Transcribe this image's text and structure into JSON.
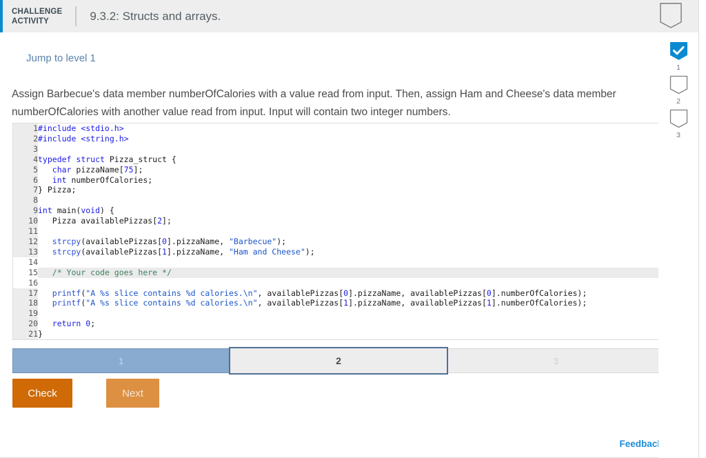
{
  "header": {
    "challenge_label": "CHALLENGE\nACTIVITY",
    "title": "9.3.2: Structs and arrays.",
    "badge_icon": "shield-outline-icon",
    "accent_color": "#0c8ad0"
  },
  "rail": {
    "items": [
      {
        "number": "1",
        "state": "complete",
        "icon": "shield-check-icon"
      },
      {
        "number": "2",
        "state": "incomplete",
        "icon": "shield-outline-icon"
      },
      {
        "number": "3",
        "state": "incomplete",
        "icon": "shield-outline-icon"
      }
    ],
    "complete_color": "#0c8ad0",
    "outline_color": "#808080"
  },
  "main": {
    "jump_link": "Jump to level 1",
    "prompt": "Assign Barbecue's data member numberOfCalories with a value read from input. Then, assign Ham and Cheese's data member numberOfCalories with another value read from input. Input will contain two integer numbers."
  },
  "code": {
    "language": "c",
    "editable_lines": [
      14,
      15,
      16
    ],
    "highlighted_line": 15,
    "lines": [
      {
        "n": 1,
        "tokens": [
          {
            "t": "#include ",
            "c": "pp"
          },
          {
            "t": "<stdio.h>",
            "c": "pp"
          }
        ]
      },
      {
        "n": 2,
        "tokens": [
          {
            "t": "#include ",
            "c": "pp"
          },
          {
            "t": "<string.h>",
            "c": "pp"
          }
        ]
      },
      {
        "n": 3,
        "tokens": []
      },
      {
        "n": 4,
        "tokens": [
          {
            "t": "typedef ",
            "c": "kw"
          },
          {
            "t": "struct ",
            "c": "kw"
          },
          {
            "t": "Pizza_struct {",
            "c": "plain"
          }
        ]
      },
      {
        "n": 5,
        "tokens": [
          {
            "t": "   ",
            "c": "plain"
          },
          {
            "t": "char",
            "c": "kw"
          },
          {
            "t": " pizzaName[",
            "c": "plain"
          },
          {
            "t": "75",
            "c": "num"
          },
          {
            "t": "];",
            "c": "plain"
          }
        ]
      },
      {
        "n": 6,
        "tokens": [
          {
            "t": "   ",
            "c": "plain"
          },
          {
            "t": "int",
            "c": "kw"
          },
          {
            "t": " numberOfCalories;",
            "c": "plain"
          }
        ]
      },
      {
        "n": 7,
        "tokens": [
          {
            "t": "} Pizza;",
            "c": "plain"
          }
        ]
      },
      {
        "n": 8,
        "tokens": []
      },
      {
        "n": 9,
        "tokens": [
          {
            "t": "int",
            "c": "kw"
          },
          {
            "t": " main(",
            "c": "plain"
          },
          {
            "t": "void",
            "c": "kw"
          },
          {
            "t": ") {",
            "c": "plain"
          }
        ]
      },
      {
        "n": 10,
        "tokens": [
          {
            "t": "   Pizza availablePizzas[",
            "c": "plain"
          },
          {
            "t": "2",
            "c": "num"
          },
          {
            "t": "];",
            "c": "plain"
          }
        ]
      },
      {
        "n": 11,
        "tokens": []
      },
      {
        "n": 12,
        "tokens": [
          {
            "t": "   ",
            "c": "plain"
          },
          {
            "t": "strcpy",
            "c": "fn"
          },
          {
            "t": "(availablePizzas[",
            "c": "plain"
          },
          {
            "t": "0",
            "c": "num"
          },
          {
            "t": "].pizzaName, ",
            "c": "plain"
          },
          {
            "t": "\"Barbecue\"",
            "c": "str"
          },
          {
            "t": ");",
            "c": "plain"
          }
        ]
      },
      {
        "n": 13,
        "tokens": [
          {
            "t": "   ",
            "c": "plain"
          },
          {
            "t": "strcpy",
            "c": "fn"
          },
          {
            "t": "(availablePizzas[",
            "c": "plain"
          },
          {
            "t": "1",
            "c": "num"
          },
          {
            "t": "].pizzaName, ",
            "c": "plain"
          },
          {
            "t": "\"Ham and Cheese\"",
            "c": "str"
          },
          {
            "t": ");",
            "c": "plain"
          }
        ]
      },
      {
        "n": 14,
        "tokens": []
      },
      {
        "n": 15,
        "tokens": [
          {
            "t": "   ",
            "c": "plain"
          },
          {
            "t": "/* Your code goes here */",
            "c": "cmt"
          }
        ]
      },
      {
        "n": 16,
        "tokens": []
      },
      {
        "n": 17,
        "tokens": [
          {
            "t": "   ",
            "c": "plain"
          },
          {
            "t": "printf",
            "c": "fn"
          },
          {
            "t": "(",
            "c": "plain"
          },
          {
            "t": "\"A %s slice contains %d calories.\\n\"",
            "c": "str"
          },
          {
            "t": ", availablePizzas[",
            "c": "plain"
          },
          {
            "t": "0",
            "c": "num"
          },
          {
            "t": "].pizzaName, availablePizzas[",
            "c": "plain"
          },
          {
            "t": "0",
            "c": "num"
          },
          {
            "t": "].numberOfCalories);",
            "c": "plain"
          }
        ]
      },
      {
        "n": 18,
        "tokens": [
          {
            "t": "   ",
            "c": "plain"
          },
          {
            "t": "printf",
            "c": "fn"
          },
          {
            "t": "(",
            "c": "plain"
          },
          {
            "t": "\"A %s slice contains %d calories.\\n\"",
            "c": "str"
          },
          {
            "t": ", availablePizzas[",
            "c": "plain"
          },
          {
            "t": "1",
            "c": "num"
          },
          {
            "t": "].pizzaName, availablePizzas[",
            "c": "plain"
          },
          {
            "t": "1",
            "c": "num"
          },
          {
            "t": "].numberOfCalories);",
            "c": "plain"
          }
        ]
      },
      {
        "n": 19,
        "tokens": []
      },
      {
        "n": 20,
        "tokens": [
          {
            "t": "   ",
            "c": "plain"
          },
          {
            "t": "return ",
            "c": "kw"
          },
          {
            "t": "0",
            "c": "num"
          },
          {
            "t": ";",
            "c": "plain"
          }
        ]
      },
      {
        "n": 21,
        "tokens": [
          {
            "t": "}",
            "c": "plain"
          }
        ]
      }
    ]
  },
  "progress": {
    "segments": [
      {
        "label": "1",
        "state": "done"
      },
      {
        "label": "2",
        "state": "current"
      },
      {
        "label": "3",
        "state": "todo"
      }
    ],
    "done_color": "#8aabd0",
    "current_border_color": "#4f6f95"
  },
  "buttons": {
    "check": "Check",
    "next": "Next",
    "check_color": "#cf6a07",
    "next_color": "#dd9042"
  },
  "footer": {
    "feedback": "Feedback?",
    "feedback_color": "#1b8ddb"
  }
}
